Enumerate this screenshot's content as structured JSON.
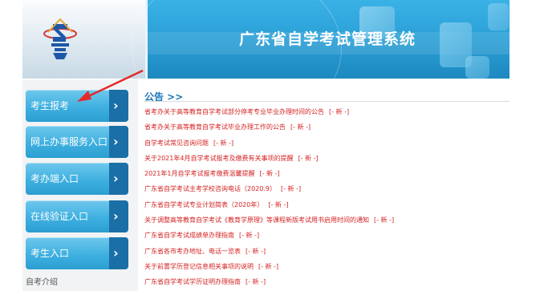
{
  "header": {
    "title": "广东省自学考试管理系统"
  },
  "sidebar": {
    "items": [
      {
        "label": "考生报考"
      },
      {
        "label": "网上办事服务入口"
      },
      {
        "label": "考办端入口"
      },
      {
        "label": "在线验证入口"
      },
      {
        "label": "考生入口"
      }
    ],
    "intro_label": "自考介绍"
  },
  "announcements": {
    "title": "公告 >>",
    "new_badge": "[- 新 -]",
    "items": [
      "省考办关于高等教育自学考试部分停考专业毕业办理时间的公告",
      "省考办关于高等教育自学考试毕业办理工作的公告",
      "自学考试常见咨询问题",
      "关于2021年4月自学考试报考及缴费有关事项的提醒",
      "2021年1月自学考试报考缴费温馨提醒",
      "广东省自学考试主考学校咨询电话（2020.9）",
      "广东省自学考试专业计划简表（2020年）",
      "关于调整高等教育自学考试《教育学原理》等课程新版考试用书启用时间的通知",
      "广东省自学考试成绩单办理指南",
      "广东省各市考办地址、电话一览表",
      "关于前置学历登记信息相关事项的说明",
      "广东省自学考试学历证明办理指南"
    ]
  },
  "colors": {
    "accent": "#1d94c9",
    "link_red": "#d42222",
    "nav_button": "#3eb0e0",
    "pointer_arrow": "#e32b2b"
  }
}
